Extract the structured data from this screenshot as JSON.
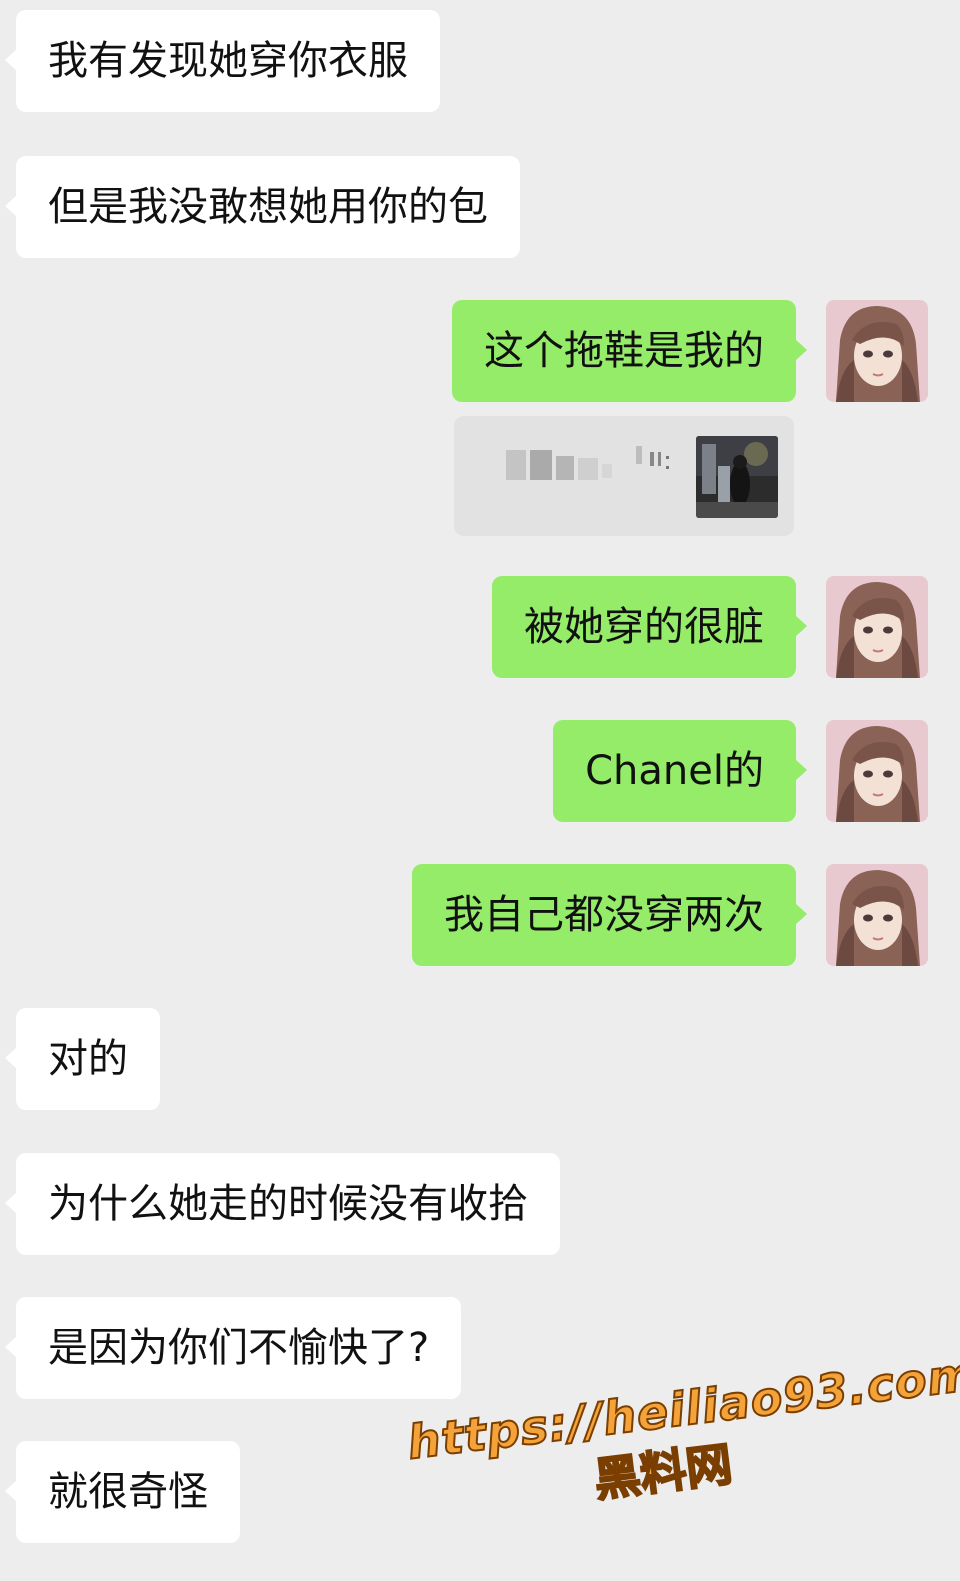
{
  "messages": [
    {
      "side": "in",
      "text": "我有发现她穿你衣服"
    },
    {
      "side": "in",
      "text": "但是我没敢想她用你的包"
    },
    {
      "side": "out",
      "text": "这个拖鞋是我的"
    },
    {
      "side": "out",
      "text": "被她穿的很脏"
    },
    {
      "side": "out",
      "text": "Chanel的"
    },
    {
      "side": "out",
      "text": "我自己都没穿两次"
    },
    {
      "side": "in",
      "text": "对的"
    },
    {
      "side": "in",
      "text": "为什么她走的时候没有收拾"
    },
    {
      "side": "in",
      "text": "是因为你们不愉快了?"
    },
    {
      "side": "in",
      "text": "就很奇怪"
    }
  ],
  "quote": {
    "label": "(blurred)",
    "thumb_icon": "photo-thumbnail"
  },
  "watermark": {
    "url": "https://heiliao93.com",
    "site": "黑料网"
  },
  "colors": {
    "background": "#ededed",
    "incoming_bubble": "#ffffff",
    "outgoing_bubble": "#95ec69",
    "watermark": "#f3a33a"
  }
}
